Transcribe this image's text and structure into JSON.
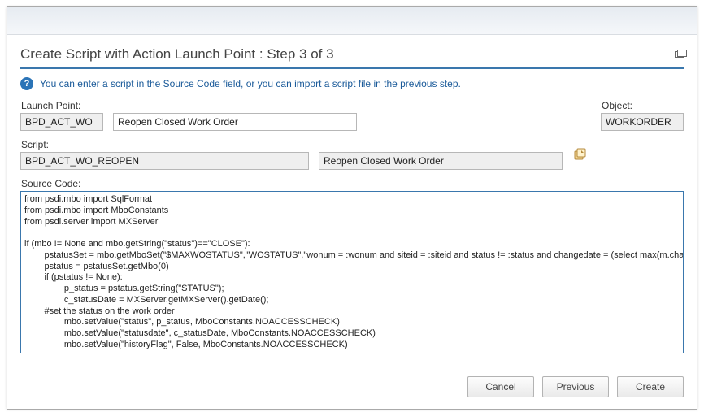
{
  "title": "Create Script with Action Launch Point : Step 3 of 3",
  "info_text": "You can enter a script in the Source Code field, or you can import a script file in the previous step.",
  "labels": {
    "launch_point": "Launch Point:",
    "object": "Object:",
    "script": "Script:",
    "source_code": "Source Code:"
  },
  "fields": {
    "launch_point_id": "BPD_ACT_WO",
    "launch_point_desc": "Reopen Closed Work Order",
    "object": "WORKORDER",
    "script_id": "BPD_ACT_WO_REOPEN",
    "script_desc": "Reopen Closed Work Order"
  },
  "source_code": "from psdi.mbo import SqlFormat\nfrom psdi.mbo import MboConstants\nfrom psdi.server import MXServer\n\nif (mbo != None and mbo.getString(\"status\")==\"CLOSE\"):\n        pstatusSet = mbo.getMboSet(\"$MAXWOSTATUS\",\"WOSTATUS\",\"wonum = :wonum and siteid = :siteid and status != :status and changedate = (select max(m.changedate) from wostatus m where m.siteid = :siteid and m.wonum = :wonum and m.status != :status)\");\n        pstatus = pstatusSet.getMbo(0)\n        if (pstatus != None):\n                p_status = pstatus.getString(\"STATUS\");\n                c_statusDate = MXServer.getMXServer().getDate();\n        #set the status on the work order\n                mbo.setValue(\"status\", p_status, MboConstants.NOACCESSCHECK)\n                mbo.setValue(\"statusdate\", c_statusDate, MboConstants.NOACCESSCHECK)\n                mbo.setValue(\"historyFlag\", False, MboConstants.NOACCESSCHECK)\n\n        #add a record in the status history table",
  "buttons": {
    "cancel": "Cancel",
    "previous": "Previous",
    "create": "Create"
  }
}
